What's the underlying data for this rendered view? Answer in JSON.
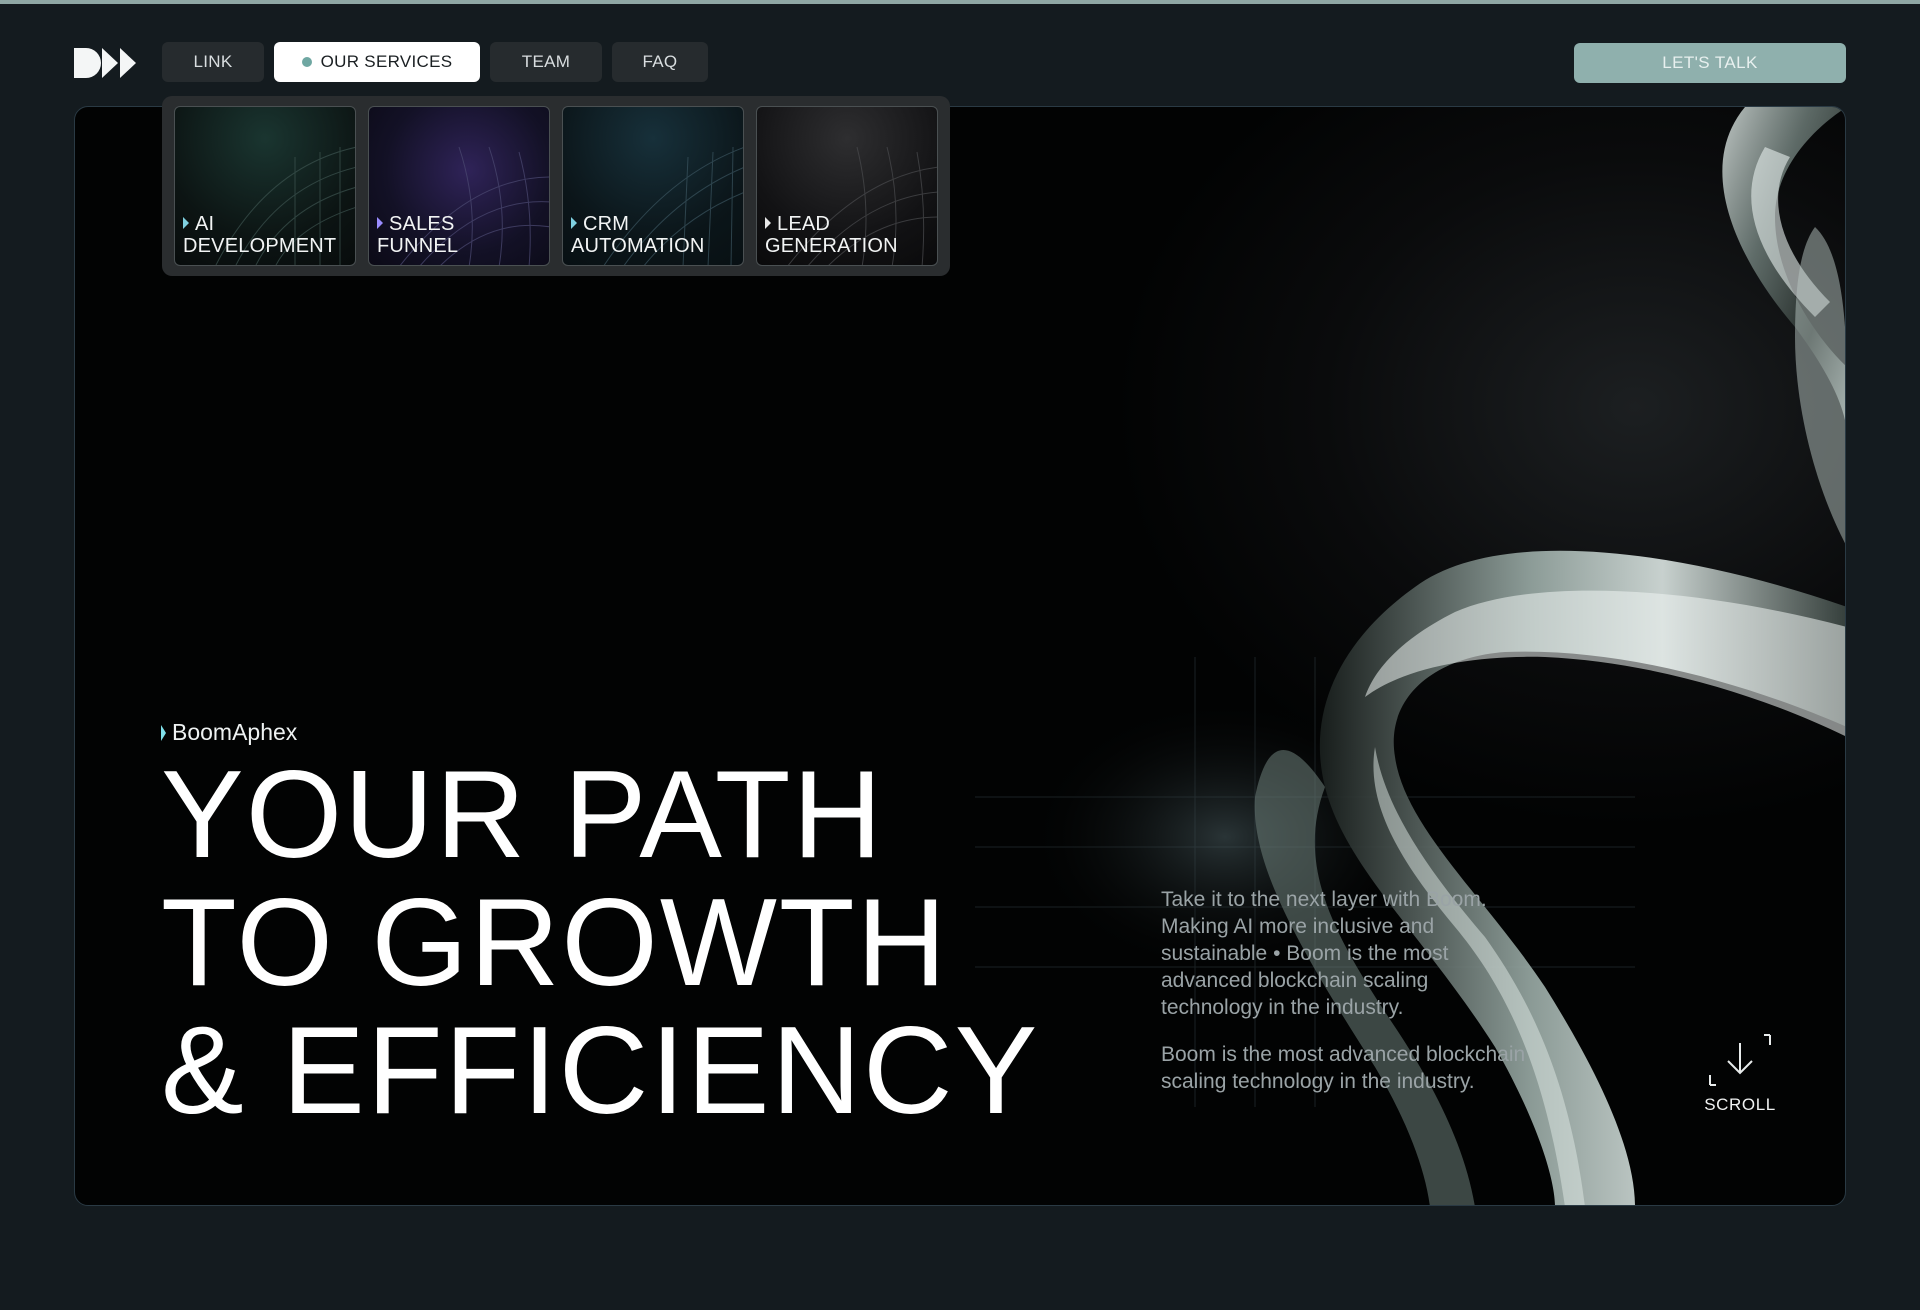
{
  "header": {
    "logo": "brand-logo",
    "nav": [
      {
        "label": "LINK",
        "active": false
      },
      {
        "label": "OUR SERVICES",
        "active": true
      },
      {
        "label": "TEAM",
        "active": false
      },
      {
        "label": "FAQ",
        "active": false
      }
    ],
    "cta_label": "LET'S TALK"
  },
  "services": [
    {
      "line1": "AI",
      "line2": "DEVELOPMENT"
    },
    {
      "line1": "SALES",
      "line2": "FUNNEL"
    },
    {
      "line1": "CRM",
      "line2": "AUTOMATION"
    },
    {
      "line1": "LEAD",
      "line2": "GENERATION"
    }
  ],
  "hero": {
    "brand": "BoomAphex",
    "headline": [
      "YOUR PATH",
      "TO GROWTH",
      "& EFFICIENCY"
    ],
    "paragraph1": "Take it to the next layer with Boom. Making AI more inclusive and sustainable • Boom is the most advanced blockchain scaling technology in the industry.",
    "paragraph2": "Boom is the most advanced blockchain scaling technology in the industry.",
    "scroll_label": "SCROLL"
  },
  "colors": {
    "background": "#141b1f",
    "accent": "#8fb0ad",
    "hero_bg": "#050606",
    "text": "#ffffff"
  }
}
